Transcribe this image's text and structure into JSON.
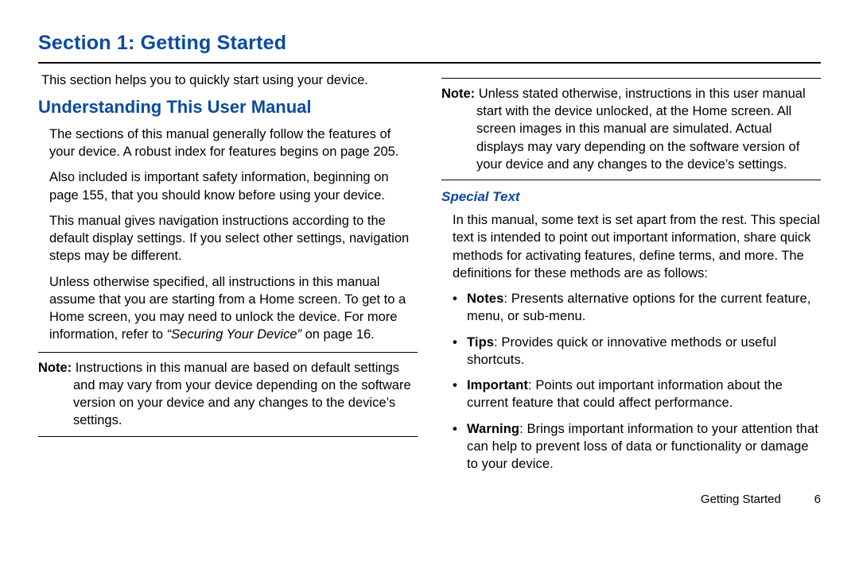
{
  "title": "Section 1: Getting Started",
  "intro": "This section helps you to quickly start using your device.",
  "leftCol": {
    "heading": "Understanding This User Manual",
    "p1": "The sections of this manual generally follow the features of your device. A robust index for features begins on page 205.",
    "p2": "Also included is important safety information, beginning on page 155, that you should know before using your device.",
    "p3": "This manual gives navigation instructions according to the default display settings. If you select other settings, navigation steps may be different.",
    "p4a": "Unless otherwise specified, all instructions in this manual assume that you are starting from a Home screen. To get to a Home screen, you may need to unlock the device. For more information, refer to ",
    "p4ref": "“Securing Your Device”",
    "p4b": " on page 16.",
    "note1Label": "Note:",
    "note1TextFirst": "Instructions in this manual are based on default settings",
    "note1TextRest": "and may vary from your device depending on the software version on your device and any changes to the device’s settings."
  },
  "rightCol": {
    "note2Label": "Note:",
    "note2TextFirst": "Unless stated otherwise, instructions in this user manual",
    "note2TextRest": "start with the device unlocked, at the Home screen. All screen images in this manual are simulated. Actual displays may vary depending on the software version of your device and any changes to the device’s settings.",
    "specialHeading": "Special Text",
    "specialIntro": "In this manual, some text is set apart from the rest. This special text is intended to point out important information, share quick methods for activating features, define terms, and more. The definitions for these methods are as follows:",
    "bullets": [
      {
        "label": "Notes",
        "text": ": Presents alternative options for the current feature, menu, or sub-menu."
      },
      {
        "label": "Tips",
        "text": ": Provides quick or innovative methods or useful shortcuts."
      },
      {
        "label": "Important",
        "text": ": Points out important information about the current feature that could affect performance."
      },
      {
        "label": "Warning",
        "text": ": Brings important information to your attention that can help to prevent loss of data or functionality or damage to your device."
      }
    ]
  },
  "footer": {
    "section": "Getting Started",
    "page": "6"
  }
}
